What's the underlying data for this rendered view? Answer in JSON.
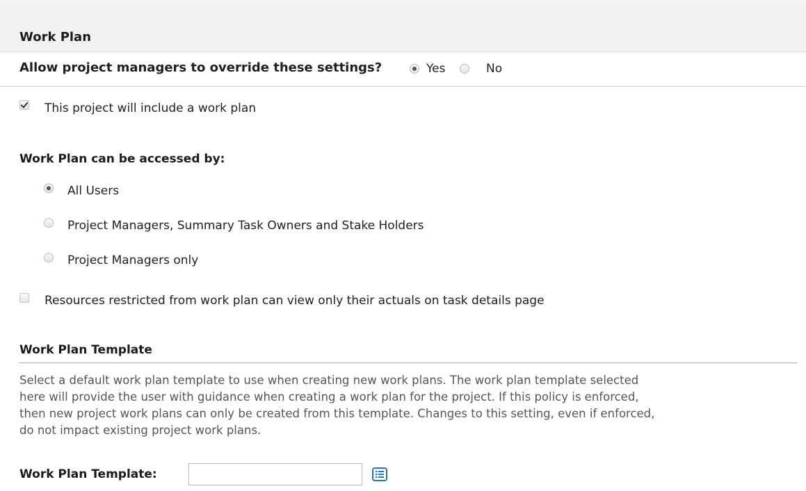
{
  "section": {
    "title": "Work Plan"
  },
  "override": {
    "label": "Allow project managers to override these settings?",
    "options": [
      {
        "label": "Yes",
        "selected": true
      },
      {
        "label": "No",
        "selected": false
      }
    ]
  },
  "include_work_plan": {
    "label": "This project will include a work plan",
    "checked": true
  },
  "access": {
    "heading": "Work Plan can be accessed by:",
    "options": [
      {
        "label": "All Users",
        "selected": true
      },
      {
        "label": "Project Managers, Summary Task Owners and Stake Holders",
        "selected": false
      },
      {
        "label": "Project Managers only",
        "selected": false
      }
    ]
  },
  "restricted_resources": {
    "label": "Resources restricted from work plan can view only their actuals on task details page",
    "checked": false
  },
  "template": {
    "heading": "Work Plan Template",
    "description": "Select a default work plan template to use when creating new work plans. The work plan template selected\nhere will provide the user with guidance when creating a work plan for the project. If this policy is enforced,\nthen new project work plans can only be created from this template. Changes to this setting, even if enforced,\ndo not impact existing project work plans.",
    "field_label": "Work Plan Template:",
    "field_value": "",
    "picker_icon": "list-icon"
  },
  "colors": {
    "accent": "#1f74c9",
    "header_bg": "#f2f2f2",
    "description_text": "#555555"
  }
}
